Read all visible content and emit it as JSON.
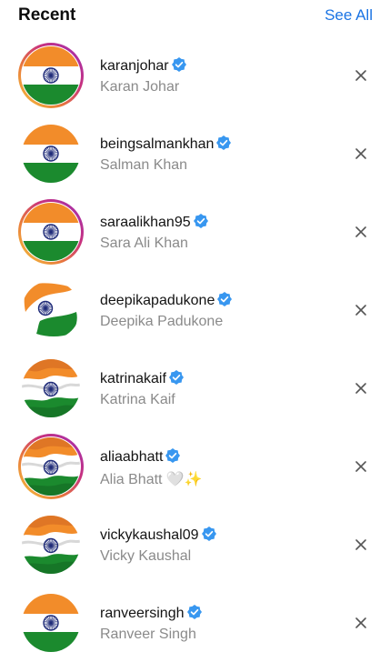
{
  "header": {
    "title": "Recent",
    "see_all_label": "See All"
  },
  "colors": {
    "accent": "#1b74e4",
    "saffron": "#f28c2a",
    "green": "#1b8a2e",
    "chakra": "#1e2a78",
    "verified": "#3897f0"
  },
  "items": [
    {
      "username": "karanjohar",
      "full_name": "Karan Johar",
      "verified": true,
      "story_ring": true,
      "avatar_style": "flat",
      "avatar_icon": "indian-flag-icon"
    },
    {
      "username": "beingsalmankhan",
      "full_name": "Salman Khan",
      "verified": true,
      "story_ring": false,
      "avatar_style": "flat",
      "avatar_icon": "indian-flag-icon"
    },
    {
      "username": "saraalikhan95",
      "full_name": "Sara Ali Khan",
      "verified": true,
      "story_ring": true,
      "avatar_style": "flat",
      "avatar_icon": "indian-flag-icon"
    },
    {
      "username": "deepikapadukone",
      "full_name": "Deepika Padukone",
      "verified": true,
      "story_ring": false,
      "avatar_style": "brush",
      "avatar_icon": "indian-flag-icon"
    },
    {
      "username": "katrinakaif",
      "full_name": "Katrina Kaif",
      "verified": true,
      "story_ring": false,
      "avatar_style": "wavy",
      "avatar_icon": "indian-flag-icon"
    },
    {
      "username": "aliaabhatt",
      "full_name": "Alia Bhatt 🤍✨",
      "verified": true,
      "story_ring": true,
      "avatar_style": "wavy",
      "avatar_icon": "indian-flag-icon"
    },
    {
      "username": "vickykaushal09",
      "full_name": "Vicky Kaushal",
      "verified": true,
      "story_ring": false,
      "avatar_style": "wavy",
      "avatar_icon": "indian-flag-icon"
    },
    {
      "username": "ranveersingh",
      "full_name": "Ranveer Singh",
      "verified": true,
      "story_ring": false,
      "avatar_style": "flat",
      "avatar_icon": "indian-flag-icon"
    }
  ]
}
